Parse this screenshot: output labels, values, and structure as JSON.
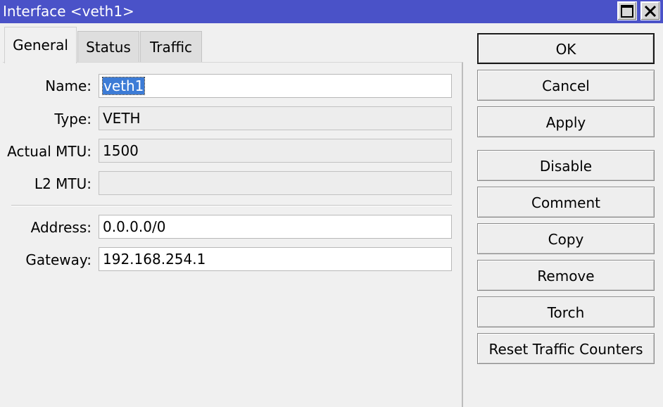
{
  "window": {
    "title": "Interface <veth1>",
    "title_bar_color": "#4a52c8",
    "controls": {
      "maximize_icon": "maximize-icon",
      "close_icon": "close-icon"
    }
  },
  "tabs": [
    {
      "label": "General",
      "active": true
    },
    {
      "label": "Status",
      "active": false
    },
    {
      "label": "Traffic",
      "active": false
    }
  ],
  "form": {
    "name": {
      "label": "Name:",
      "value": "veth1",
      "selected": true
    },
    "type": {
      "label": "Type:",
      "value": "VETH",
      "readonly": true
    },
    "actual_mtu": {
      "label": "Actual MTU:",
      "value": "1500",
      "readonly": true
    },
    "l2_mtu": {
      "label": "L2 MTU:",
      "value": "",
      "readonly": true
    },
    "address": {
      "label": "Address:",
      "value": "0.0.0.0/0"
    },
    "gateway": {
      "label": "Gateway:",
      "value": "192.168.254.1"
    }
  },
  "buttons": {
    "ok": "OK",
    "cancel": "Cancel",
    "apply": "Apply",
    "disable": "Disable",
    "comment": "Comment",
    "copy": "Copy",
    "remove": "Remove",
    "torch": "Torch",
    "reset_traffic_counters": "Reset Traffic Counters"
  }
}
